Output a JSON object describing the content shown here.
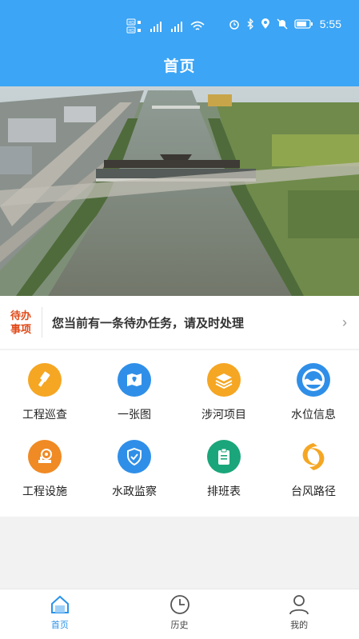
{
  "status_bar": {
    "left_icons": [
      "hd-signal-icon",
      "signal-5g-icon",
      "signal-4g-icon",
      "wifi-icon"
    ],
    "right_icons": [
      "alarm-icon",
      "bluetooth-icon",
      "location-icon",
      "mute-icon",
      "battery-icon"
    ],
    "time": "5:55"
  },
  "header": {
    "title": "首页"
  },
  "banner": {
    "image": "aerial-river-bridge-photo"
  },
  "notice": {
    "tag_line1": "待办",
    "tag_line2": "事项",
    "message": "您当前有一条待办任务，请及时处理",
    "arrow": "›"
  },
  "grid": {
    "items": [
      {
        "label": "工程巡查",
        "icon": "flashlight-icon",
        "color": "#f5a623"
      },
      {
        "label": "一张图",
        "icon": "map-pin-icon",
        "color": "#2f8fe8"
      },
      {
        "label": "涉河项目",
        "icon": "layers-icon",
        "color": "#f5a623"
      },
      {
        "label": "水位信息",
        "icon": "water-level-icon",
        "color": "#2f8fe8"
      },
      {
        "label": "工程设施",
        "icon": "facility-icon",
        "color": "#f08a24"
      },
      {
        "label": "水政监察",
        "icon": "shield-icon",
        "color": "#2f8fe8"
      },
      {
        "label": "排班表",
        "icon": "clipboard-icon",
        "color": "#1aa67a"
      },
      {
        "label": "台风路径",
        "icon": "typhoon-icon",
        "color": "#f5a623"
      }
    ]
  },
  "tabbar": {
    "tabs": [
      {
        "label": "首页",
        "icon": "home-icon",
        "active": true
      },
      {
        "label": "历史",
        "icon": "clock-icon",
        "active": false
      },
      {
        "label": "我的",
        "icon": "user-icon",
        "active": false
      }
    ]
  },
  "colors": {
    "primary": "#3ca5f5",
    "tab_active": "#2a93ea",
    "notice_tag": "#e04a1a"
  }
}
